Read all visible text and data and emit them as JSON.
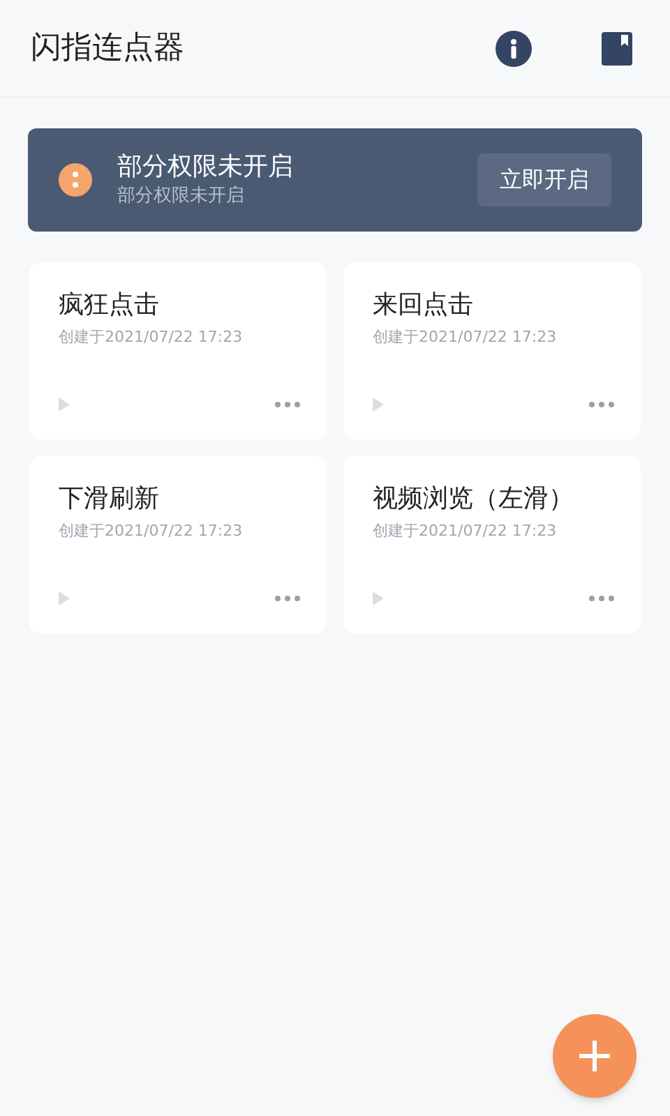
{
  "app_bar": {
    "title": "闪指连点器"
  },
  "permission_banner": {
    "title": "部分权限未开启",
    "subtitle": "部分权限未开启",
    "button": "立即开启"
  },
  "scripts": [
    {
      "name": "疯狂点击",
      "created": "创建于2021/07/22 17:23"
    },
    {
      "name": "来回点击",
      "created": "创建于2021/07/22 17:23"
    },
    {
      "name": "下滑刷新",
      "created": "创建于2021/07/22 17:23"
    },
    {
      "name": "视频浏览（左滑）",
      "created": "创建于2021/07/22 17:23"
    }
  ]
}
